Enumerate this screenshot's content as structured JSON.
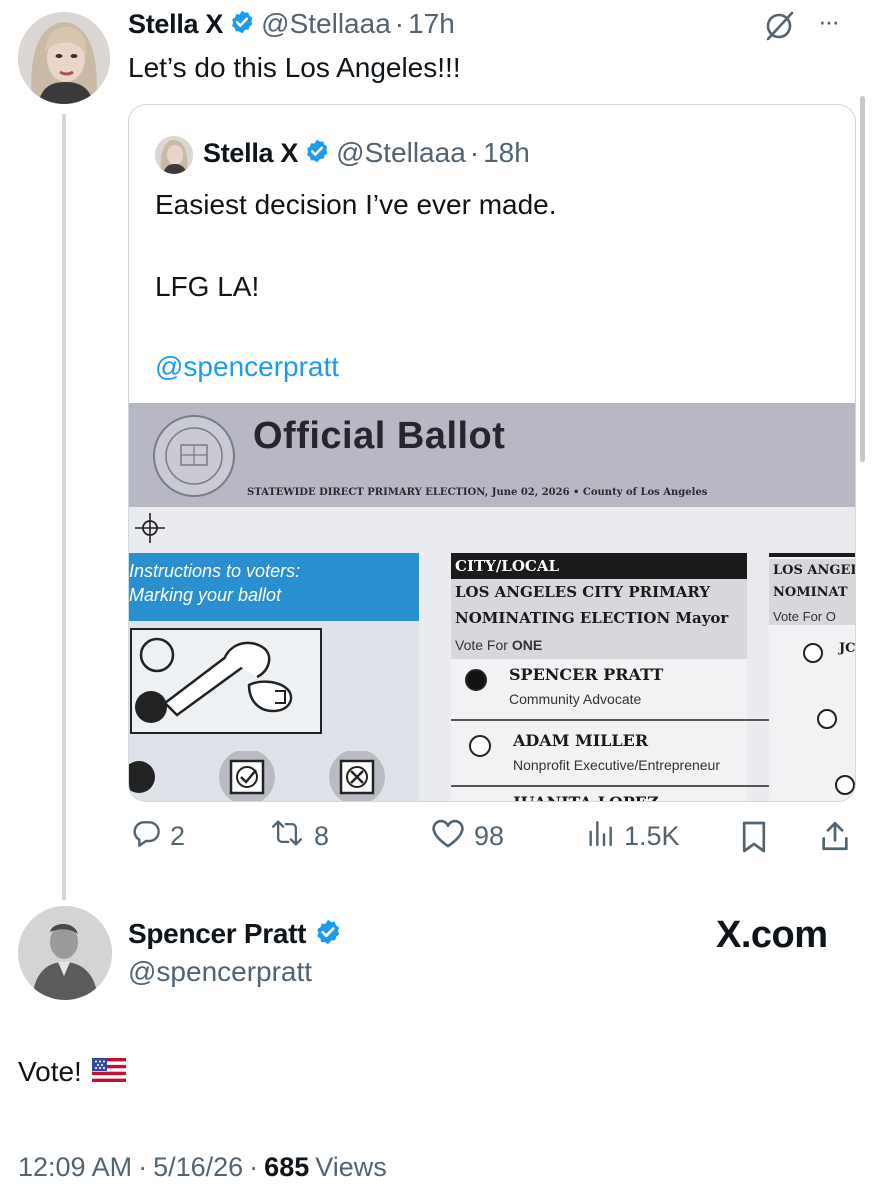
{
  "top_tweet": {
    "author_name": "Stella X",
    "handle": "@Stellaaa",
    "dot": "·",
    "time": "17h",
    "text": "Let’s do this Los Angeles!!!",
    "more": "···",
    "quote": {
      "author_name": "Stella X",
      "handle": "@Stellaaa",
      "dot": "·",
      "time": "18h",
      "line1": "Easiest decision I’ve ever made.",
      "line2": "LFG LA!",
      "mention": "@spencerpratt"
    },
    "stats": {
      "replies": "2",
      "reposts": "8",
      "likes": "98",
      "views": "1.5K"
    }
  },
  "ballot": {
    "title": "Official Ballot",
    "subtitle": "STATEWIDE DIRECT PRIMARY ELECTION, June 02, 2026 • County of Los Angeles",
    "instructions_line1": "Instructions to voters:",
    "instructions_line2": "Marking your ballot",
    "section_header": "CITY/LOCAL",
    "contest_line1": "LOS ANGELES CITY PRIMARY",
    "contest_line2": "NOMINATING ELECTION Mayor",
    "vote_for_prefix": "Vote For ",
    "vote_for_count": "ONE",
    "candidates": [
      {
        "name": "SPENCER PRATT",
        "title": "Community Advocate",
        "selected": true
      },
      {
        "name": "ADAM MILLER",
        "title": "Nonprofit Executive/Entrepreneur",
        "selected": false
      },
      {
        "name": "JUANITA LOPEZ",
        "title": "",
        "selected": false
      }
    ],
    "right_col_line1": "LOS ANGEI",
    "right_col_line2": "NOMINAT",
    "right_col_vote": "Vote For O",
    "right_col_candidate": "JC"
  },
  "main_tweet": {
    "author_name": "Spencer Pratt",
    "handle": "@spencerpratt",
    "brand": "X.com",
    "text": "Vote!",
    "flag_icon": "us-flag-icon",
    "time": "12:09 AM",
    "dot": "·",
    "date": "5/16/26",
    "views_count": "685",
    "views_label": "Views"
  },
  "colors": {
    "verified_blue": "#1d9bf0",
    "secondary_text": "#536471",
    "border": "#cfd9de",
    "ballot_blue": "#2a8fce",
    "ballot_header": "#b7b8c4"
  }
}
